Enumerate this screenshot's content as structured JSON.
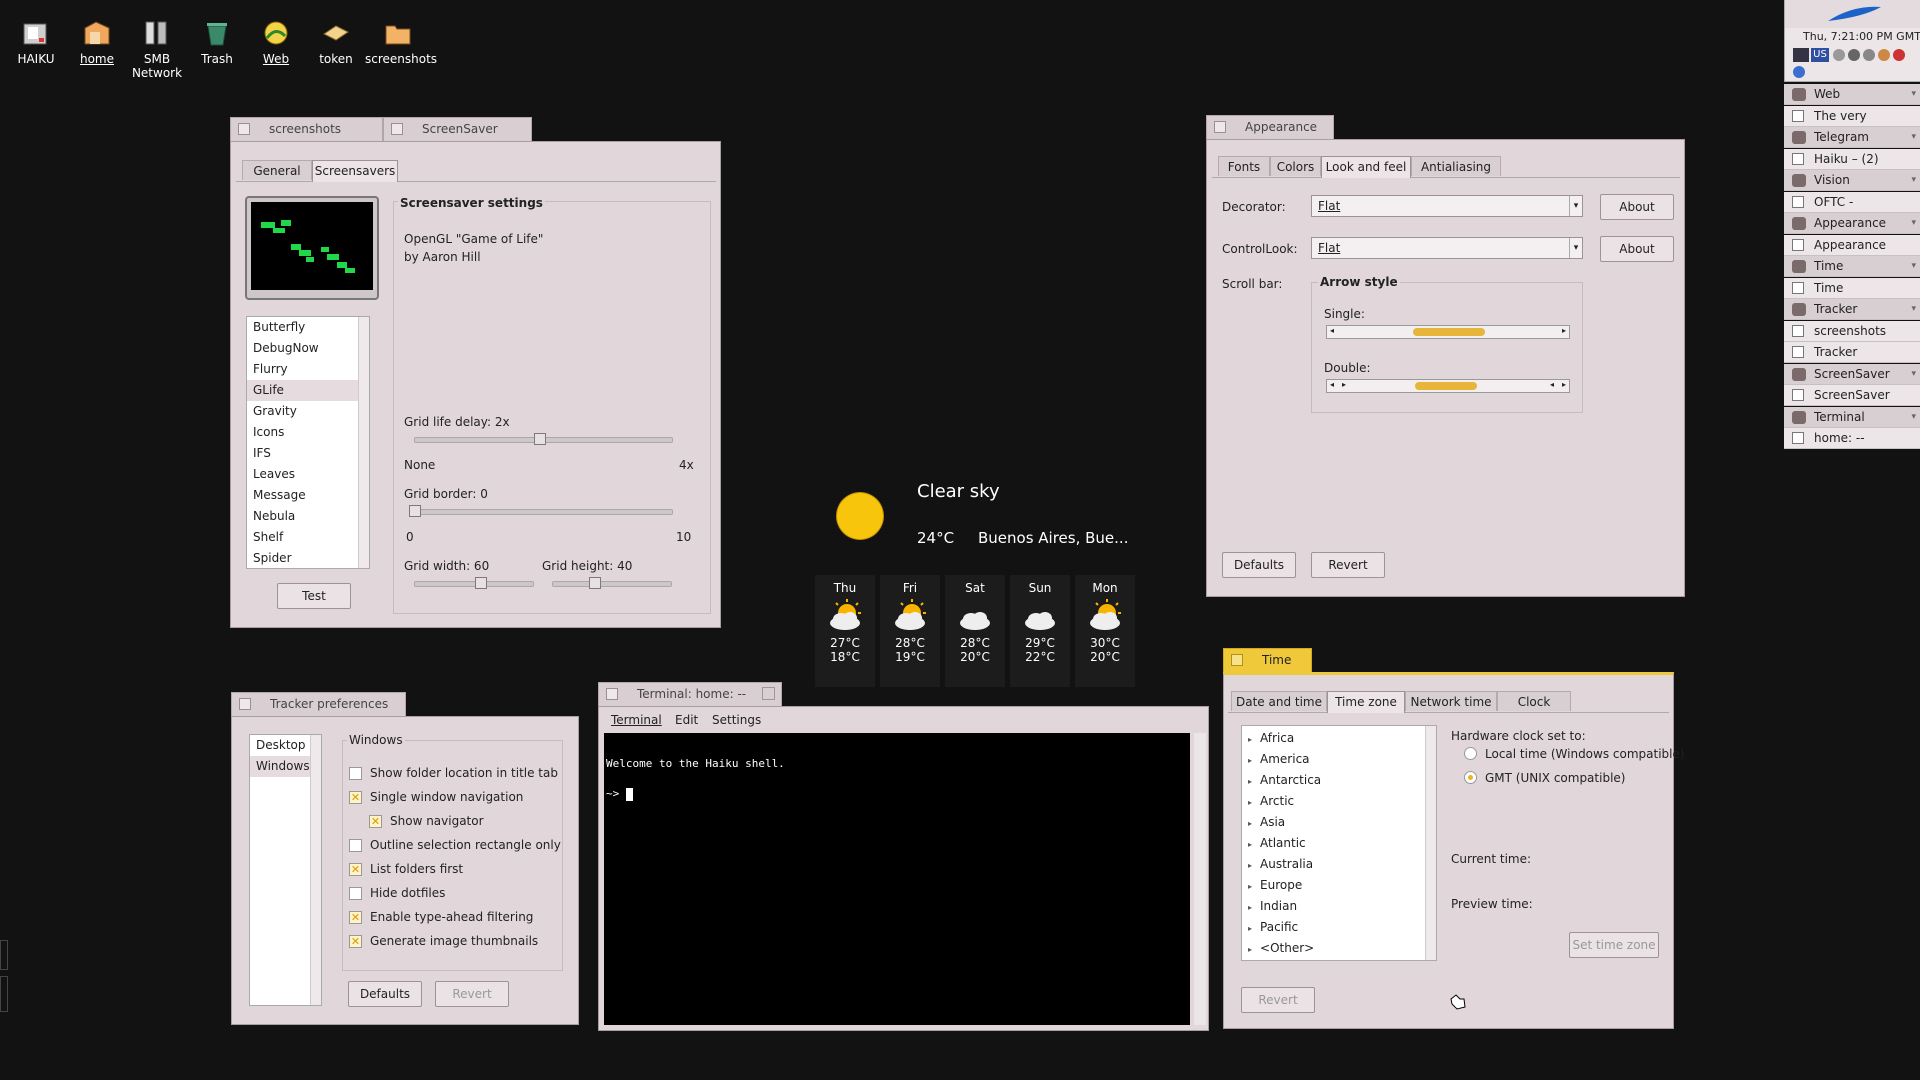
{
  "desktop": {
    "icons": [
      {
        "label": "HAIKU",
        "name": "haiku-drive-icon"
      },
      {
        "label": "home",
        "name": "home-folder-icon"
      },
      {
        "label": "SMB Network",
        "name": "network-icon"
      },
      {
        "label": "Trash",
        "name": "trash-icon"
      },
      {
        "label": "Web",
        "name": "web-browser-icon"
      },
      {
        "label": "token",
        "name": "token-file-icon"
      },
      {
        "label": "screenshots",
        "name": "screenshots-folder-icon"
      }
    ]
  },
  "screensaver_window": {
    "tab1": "screenshots",
    "tab2": "ScreenSaver",
    "tabs": [
      "General",
      "Screensavers"
    ],
    "list": [
      "Butterfly",
      "DebugNow",
      "Flurry",
      "GLife",
      "Gravity",
      "Icons",
      "IFS",
      "Leaves",
      "Message",
      "Nebula",
      "Shelf",
      "Spider"
    ],
    "selected": "GLife",
    "test_label": "Test",
    "settings_title": "Screensaver settings",
    "desc1": "OpenGL \"Game of Life\"",
    "desc2": "by Aaron Hill",
    "delay_label": "Grid life delay: 2x",
    "delay_min": "None",
    "delay_max": "4x",
    "border_label": "Grid border: 0",
    "border_min": "0",
    "border_max": "10",
    "width_label": "Grid width: 60",
    "height_label": "Grid height: 40"
  },
  "appearance_window": {
    "title": "Appearance",
    "tabs": [
      "Fonts",
      "Colors",
      "Look and feel",
      "Antialiasing"
    ],
    "decorator_label": "Decorator:",
    "decorator_value": "Flat",
    "controllook_label": "ControlLook:",
    "controllook_value": "Flat",
    "about_label": "About",
    "scrollbar_label": "Scroll bar:",
    "arrow_style": "Arrow style",
    "single": "Single:",
    "double": "Double:",
    "defaults": "Defaults",
    "revert": "Revert"
  },
  "weather": {
    "condition": "Clear sky",
    "temp": "24°C",
    "location": "Buenos Aires, Bue...",
    "forecast": [
      {
        "day": "Thu",
        "hi": "27°C",
        "lo": "18°C",
        "icon": "partly-sunny-icon"
      },
      {
        "day": "Fri",
        "hi": "28°C",
        "lo": "19°C",
        "icon": "partly-sunny-icon"
      },
      {
        "day": "Sat",
        "hi": "28°C",
        "lo": "20°C",
        "icon": "cloudy-icon"
      },
      {
        "day": "Sun",
        "hi": "29°C",
        "lo": "22°C",
        "icon": "cloudy-icon"
      },
      {
        "day": "Mon",
        "hi": "30°C",
        "lo": "20°C",
        "icon": "partly-sunny-icon"
      }
    ]
  },
  "tracker_window": {
    "title": "Tracker preferences",
    "list": [
      "Desktop",
      "Windows"
    ],
    "selected": "Windows",
    "group": "Windows",
    "options": [
      {
        "label": "Show folder location in title tab",
        "checked": false,
        "indent": false
      },
      {
        "label": "Single window navigation",
        "checked": true,
        "indent": false
      },
      {
        "label": "Show navigator",
        "checked": true,
        "indent": true
      },
      {
        "label": "Outline selection rectangle only",
        "checked": false,
        "indent": false
      },
      {
        "label": "List folders first",
        "checked": true,
        "indent": false
      },
      {
        "label": "Hide dotfiles",
        "checked": false,
        "indent": false
      },
      {
        "label": "Enable type-ahead filtering",
        "checked": true,
        "indent": false
      },
      {
        "label": "Generate image thumbnails",
        "checked": true,
        "indent": false
      }
    ],
    "defaults": "Defaults",
    "revert": "Revert"
  },
  "terminal_window": {
    "title": "Terminal: home: --",
    "menu": [
      "Terminal",
      "Edit",
      "Settings"
    ],
    "line1": "Welcome to the Haiku shell.",
    "prompt": "~> "
  },
  "time_window": {
    "title": "Time",
    "tabs": [
      "Date and time",
      "Time zone",
      "Network time",
      "Clock"
    ],
    "zones": [
      "Africa",
      "America",
      "Antarctica",
      "Arctic",
      "Asia",
      "Atlantic",
      "Australia",
      "Europe",
      "Indian",
      "Pacific",
      "<Other>"
    ],
    "hw_label": "Hardware clock set to:",
    "opt_local": "Local time (Windows compatible)",
    "opt_gmt": "GMT (UNIX compatible)",
    "current": "Current time:",
    "preview": "Preview time:",
    "set_tz": "Set time zone",
    "revert": "Revert"
  },
  "deskbar": {
    "clock": "Thu, 7:21:00 PM GMT",
    "keymap": "US",
    "items": [
      {
        "label": "Web",
        "type": "app",
        "icon": "web-icon"
      },
      {
        "label": "The very ...munity",
        "type": "sub"
      },
      {
        "label": "Telegram",
        "type": "app",
        "icon": "telegram-icon"
      },
      {
        "label": "Haiku – (2)",
        "type": "sub"
      },
      {
        "label": "Vision",
        "type": "app",
        "icon": "vision-icon"
      },
      {
        "label": "OFTC - [...oftc.net]",
        "type": "sub"
      },
      {
        "label": "Appearance",
        "type": "app",
        "icon": "appearance-icon"
      },
      {
        "label": "Appearance",
        "type": "sub"
      },
      {
        "label": "Time",
        "type": "app",
        "icon": "time-icon"
      },
      {
        "label": "Time",
        "type": "sub"
      },
      {
        "label": "Tracker",
        "type": "app",
        "icon": "tracker-icon"
      },
      {
        "label": "screenshots",
        "type": "sub"
      },
      {
        "label": "Tracker ...ferences",
        "type": "sub"
      },
      {
        "label": "ScreenSaver",
        "type": "app",
        "icon": "screensaver-icon"
      },
      {
        "label": "ScreenSaver",
        "type": "sub"
      },
      {
        "label": "Terminal",
        "type": "app",
        "icon": "terminal-icon"
      },
      {
        "label": "home: --",
        "type": "sub"
      }
    ]
  },
  "colors": {
    "accent": "#f0c93a",
    "desktop": "#121212",
    "window": "#e1d7da"
  }
}
